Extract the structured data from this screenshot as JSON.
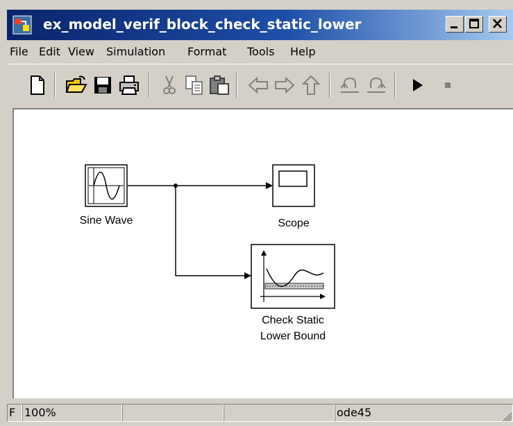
{
  "window": {
    "title": "ex_model_verif_block_check_static_lower",
    "title_icon": "simulink-model-icon",
    "controls": [
      "minimize",
      "maximize",
      "close"
    ]
  },
  "menu": {
    "items": [
      {
        "label": "File"
      },
      {
        "label": "Edit"
      },
      {
        "label": "View"
      },
      {
        "label": "Simulation"
      },
      {
        "label": "Format"
      },
      {
        "label": "Tools"
      },
      {
        "label": "Help"
      }
    ]
  },
  "toolbar": {
    "buttons": [
      {
        "icon": "new-document-icon"
      },
      {
        "icon": "open-folder-icon"
      },
      {
        "icon": "save-icon"
      },
      {
        "icon": "print-icon"
      },
      {
        "icon": "cut-icon"
      },
      {
        "icon": "copy-icon"
      },
      {
        "icon": "paste-icon"
      },
      {
        "icon": "back-arrow-icon"
      },
      {
        "icon": "forward-arrow-icon"
      },
      {
        "icon": "up-arrow-icon"
      },
      {
        "icon": "undo-icon"
      },
      {
        "icon": "redo-icon"
      },
      {
        "icon": "start-simulation-icon"
      },
      {
        "icon": "stop-simulation-icon"
      }
    ]
  },
  "diagram": {
    "blocks": [
      {
        "id": "sine-wave",
        "label": "Sine Wave"
      },
      {
        "id": "scope",
        "label": "Scope"
      },
      {
        "id": "check-static-lower-bound",
        "label_line1": "Check Static",
        "label_line2": "Lower Bound"
      }
    ]
  },
  "status": {
    "left": "F",
    "zoom": "100%",
    "solver": "ode45"
  },
  "colors": {
    "title_start": "#0a246a",
    "title_end": "#a6caf0",
    "chrome": "#d4d0c8",
    "canvas": "#ffffff"
  }
}
